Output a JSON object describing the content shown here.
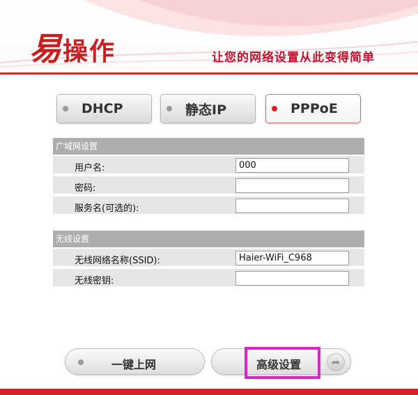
{
  "header": {
    "logo_big": "易",
    "logo_small": "操作",
    "slogan": "让您的网络设置从此变得简单"
  },
  "modes": {
    "dhcp": "DHCP",
    "static_ip": "静态IP",
    "pppoe": "PPPoE",
    "selected": "PPPoE"
  },
  "wan": {
    "title": "广域网设置",
    "username_label": "用户名:",
    "username_value": "000",
    "password_label": "密码:",
    "password_value": "",
    "service_label": "服务名(可选的):",
    "service_value": ""
  },
  "wireless": {
    "title": "无线设置",
    "ssid_label": "无线网络名称(SSID):",
    "ssid_value": "Haier-WiFi_C968",
    "key_label": "无线密钥:",
    "key_value": ""
  },
  "actions": {
    "connect_label": "一键上网",
    "advanced_label": "高级设置"
  },
  "colors": {
    "brand_red": "#d3232a",
    "highlight_magenta": "#e023c8"
  }
}
